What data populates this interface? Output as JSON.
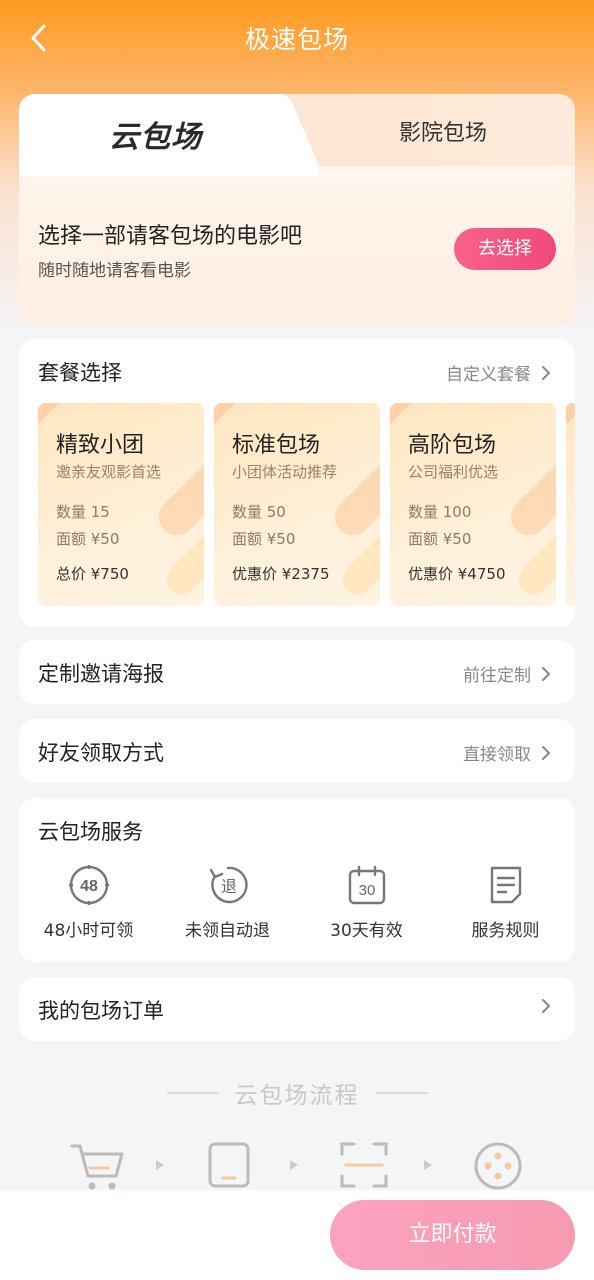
{
  "header": {
    "title": "极速包场"
  },
  "hero": {
    "tab_active": "云包场",
    "tab_inactive": "影院包场",
    "title": "选择一部请客包场的电影吧",
    "subtitle": "随时随地请客看电影",
    "button": "去选择"
  },
  "packages": {
    "title": "套餐选择",
    "custom_link": "自定义套餐",
    "items": [
      {
        "name": "精致小团",
        "desc": "邀亲友观影首选",
        "qty": "数量 15",
        "face": "面额 ¥50",
        "price": "总价 ¥750"
      },
      {
        "name": "标准包场",
        "desc": "小团体活动推荐",
        "qty": "数量 50",
        "face": "面额 ¥50",
        "price": "优惠价 ¥2375"
      },
      {
        "name": "高阶包场",
        "desc": "公司福利优选",
        "qty": "数量 100",
        "face": "面额 ¥50",
        "price": "优惠价 ¥4750"
      }
    ]
  },
  "poster": {
    "title": "定制邀请海报",
    "link": "前往定制"
  },
  "claim": {
    "title": "好友领取方式",
    "link": "直接领取"
  },
  "service": {
    "title": "云包场服务",
    "items": [
      {
        "label": "48小时可领",
        "icon": "clock-48-icon",
        "icon_text": "48"
      },
      {
        "label": "未领自动退",
        "icon": "refund-icon",
        "icon_text": "退"
      },
      {
        "label": "30天有效",
        "icon": "calendar-30-icon",
        "icon_text": "30"
      },
      {
        "label": "服务规则",
        "icon": "document-rules-icon"
      }
    ]
  },
  "orders": {
    "title": "我的包场订单"
  },
  "process": {
    "title": "云包场流程"
  },
  "footer": {
    "pay_button": "立即付款"
  },
  "colors": {
    "brand_orange": "#ff9a1f",
    "pink": "#f0497c",
    "pay_pink": "#fca2bf"
  }
}
